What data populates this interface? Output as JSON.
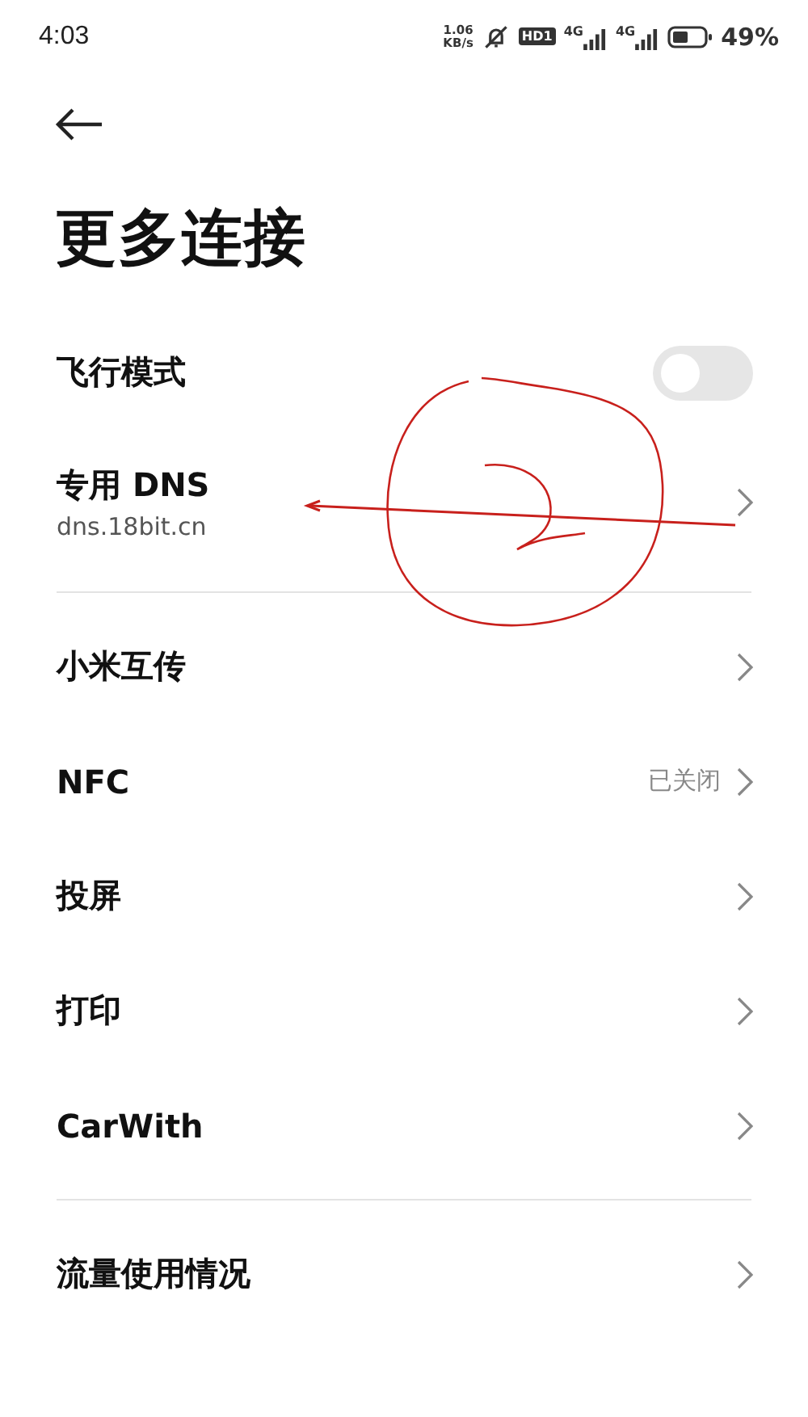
{
  "status_bar": {
    "time": "4:03",
    "net_speed": [
      "1.06",
      "KB/s"
    ],
    "hd_badge": "HD1",
    "sim_labels": [
      "4G",
      "4G"
    ],
    "battery_percent": "49%"
  },
  "title": "更多连接",
  "groups": [
    {
      "rows": [
        {
          "kind": "toggle",
          "label": "飞行模式",
          "on": false
        },
        {
          "kind": "link",
          "label": "专用 DNS",
          "subtitle": "dns.18bit.cn"
        }
      ]
    },
    {
      "rows": [
        {
          "kind": "link",
          "label": "小米互传"
        },
        {
          "kind": "link",
          "label": "NFC",
          "value": "已关闭"
        },
        {
          "kind": "link",
          "label": "投屏"
        },
        {
          "kind": "link",
          "label": "打印"
        },
        {
          "kind": "link",
          "label": "CarWith"
        }
      ]
    },
    {
      "rows": [
        {
          "kind": "link",
          "label": "流量使用情况"
        }
      ]
    }
  ]
}
